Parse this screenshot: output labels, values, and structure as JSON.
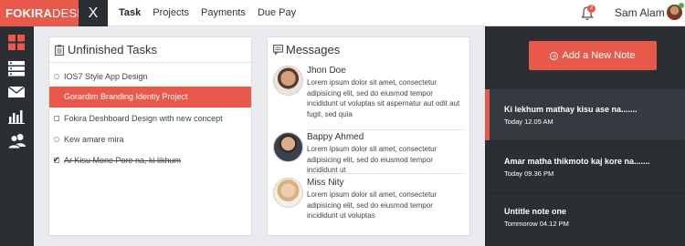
{
  "brand": {
    "bold": "FOKIRA",
    "light": "DESH"
  },
  "close_label": "X",
  "nav": [
    "Task",
    "Projects",
    "Payments",
    "Due Pay"
  ],
  "notifications": {
    "count": "2",
    "icon": "bell-icon"
  },
  "user": {
    "name": "Sam Alam"
  },
  "sidebar": [
    {
      "icon": "dashboard-grid-icon"
    },
    {
      "icon": "server-icon"
    },
    {
      "icon": "mail-icon"
    },
    {
      "icon": "bar-chart-icon"
    },
    {
      "icon": "users-icon"
    }
  ],
  "tasks": {
    "title": "Unfinished Tasks",
    "items": [
      {
        "label": "IOS7 Style App Design",
        "state": "todo"
      },
      {
        "label": "Gorardim Branding Identiy Project",
        "state": "active"
      },
      {
        "label": "Fokira Deshboard Design with new concept",
        "state": "todo"
      },
      {
        "label": "Kew amare mira",
        "state": "todo"
      },
      {
        "label": "Ar Kisu Mone Pore na, ki likhum",
        "state": "done"
      }
    ]
  },
  "messages": {
    "title": "Messages",
    "items": [
      {
        "name": "Jhon Doe",
        "text": "Lorem ipsum dolor sit amet, consectetur adipisicing elit, sed do eiusmod tempor incididunt ut voluptas sit aspernatur aut odit aut fugit, sed quia"
      },
      {
        "name": "Bappy Ahmed",
        "text": "Lorem ipsum dolor sit amet, consectetur adipisicing elit, sed do eiusmod tempor incididunt ut"
      },
      {
        "name": "Miss Nity",
        "text": "Lorem ipsum dolor sit amet, consectetur adipisicing elit, sed do eiusmod tempor incididunt ut voluptas"
      }
    ]
  },
  "notes": {
    "add_label": "Add a New Note",
    "items": [
      {
        "title": "Ki lekhum mathay kisu ase na.......",
        "time": "Today 12.05 AM"
      },
      {
        "title": "Amar matha thikmoto kaj kore na.......",
        "time": "Today 09.36 PM"
      },
      {
        "title": "Untitle note one",
        "time": "Tommorow 04.12 PM"
      }
    ]
  },
  "colors": {
    "accent": "#e8584b",
    "dark": "#2b2f33",
    "background": "#e9ebee"
  }
}
